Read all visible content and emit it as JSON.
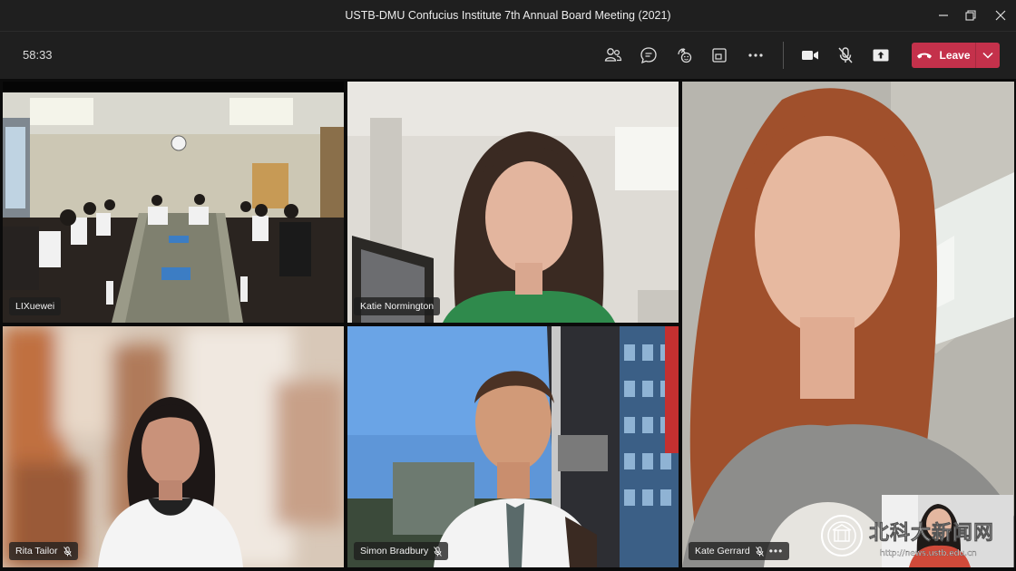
{
  "window": {
    "title": "USTB-DMU Confucius Institute 7th Annual Board Meeting (2021)",
    "controls": [
      "minimize-icon",
      "restore-icon",
      "close-icon"
    ]
  },
  "toolbar": {
    "timer": "58:33",
    "buttons": [
      "people-icon",
      "chat-icon",
      "reactions-icon",
      "rooms-icon",
      "more-icon",
      "camera-icon",
      "mic-off-icon",
      "share-icon"
    ],
    "leave_label": "Leave",
    "leave_color": "#c4314b"
  },
  "participants": [
    {
      "name": "LIXuewei",
      "muted": false
    },
    {
      "name": "Katie Normington",
      "muted": false
    },
    {
      "name": "Kate Gerrard",
      "muted": true,
      "more": "•••"
    },
    {
      "name": "Rita Tailor",
      "muted": true
    },
    {
      "name": "Simon Bradbury",
      "muted": true
    }
  ],
  "watermark": {
    "logo_text": "北科大新闻网",
    "url": "http://news.ustb.edu.cn"
  }
}
